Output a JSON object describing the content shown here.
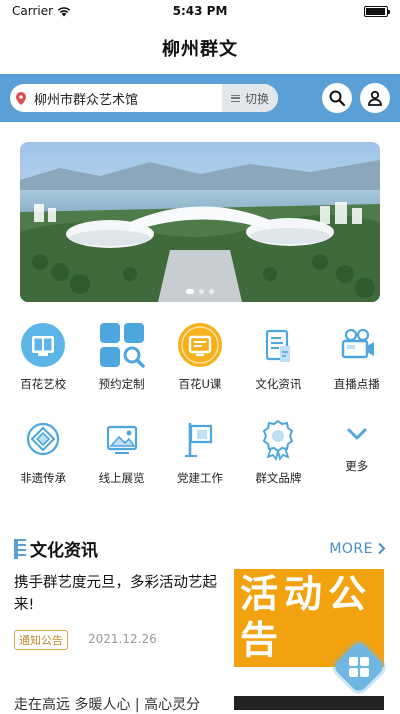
{
  "status": {
    "carrier": "Carrier",
    "time": "5:43 PM"
  },
  "header": {
    "title": "柳州群文"
  },
  "search": {
    "location": "柳州市群众艺术馆",
    "switch_label": "切换"
  },
  "grid": {
    "row1": [
      {
        "label": "百花艺校",
        "icon": "book-icon"
      },
      {
        "label": "预约定制",
        "icon": "grid-search-icon"
      },
      {
        "label": "百花U课",
        "icon": "course-icon"
      },
      {
        "label": "文化资讯",
        "icon": "news-icon"
      },
      {
        "label": "直播点播",
        "icon": "video-camera-icon"
      }
    ],
    "row2": [
      {
        "label": "非遗传承",
        "icon": "heritage-icon"
      },
      {
        "label": "线上展览",
        "icon": "gallery-icon"
      },
      {
        "label": "党建工作",
        "icon": "flag-icon"
      },
      {
        "label": "群文品牌",
        "icon": "award-icon"
      },
      {
        "label": "更多",
        "icon": "chevron-down-icon"
      }
    ]
  },
  "section": {
    "title": "文化资讯",
    "more_label": "MORE"
  },
  "news": [
    {
      "title": "携手群艺度元旦，多彩活动艺起来!",
      "tag": "通知公告",
      "date": "2021.12.26",
      "thumb_text": "活动公告"
    },
    {
      "title": "走在高远 多暖人心 | 高心灵分"
    }
  ],
  "colors": {
    "accent": "#5aa0d6",
    "tag": "#c08a2b",
    "thumb": "#f2a20f"
  }
}
